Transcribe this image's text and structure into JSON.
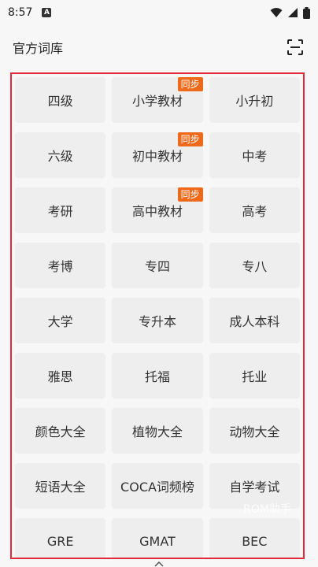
{
  "status_bar": {
    "time": "8:57",
    "notice_glyph": "A"
  },
  "header": {
    "title": "官方词库",
    "scan_icon": "scan-icon"
  },
  "grid": {
    "items": [
      {
        "label": "四级",
        "badge": ""
      },
      {
        "label": "小学教材",
        "badge": "同步"
      },
      {
        "label": "小升初",
        "badge": ""
      },
      {
        "label": "六级",
        "badge": ""
      },
      {
        "label": "初中教材",
        "badge": "同步"
      },
      {
        "label": "中考",
        "badge": ""
      },
      {
        "label": "考研",
        "badge": ""
      },
      {
        "label": "高中教材",
        "badge": "同步"
      },
      {
        "label": "高考",
        "badge": ""
      },
      {
        "label": "考博",
        "badge": ""
      },
      {
        "label": "专四",
        "badge": ""
      },
      {
        "label": "专八",
        "badge": ""
      },
      {
        "label": "大学",
        "badge": ""
      },
      {
        "label": "专升本",
        "badge": ""
      },
      {
        "label": "成人本科",
        "badge": ""
      },
      {
        "label": "雅思",
        "badge": ""
      },
      {
        "label": "托福",
        "badge": ""
      },
      {
        "label": "托业",
        "badge": ""
      },
      {
        "label": "颜色大全",
        "badge": ""
      },
      {
        "label": "植物大全",
        "badge": ""
      },
      {
        "label": "动物大全",
        "badge": ""
      },
      {
        "label": "短语大全",
        "badge": ""
      },
      {
        "label": "COCA词频榜",
        "badge": ""
      },
      {
        "label": "自学考试",
        "badge": ""
      },
      {
        "label": "GRE",
        "badge": ""
      },
      {
        "label": "GMAT",
        "badge": ""
      },
      {
        "label": "BEC",
        "badge": ""
      }
    ]
  },
  "watermark": "ROM助手",
  "colors": {
    "badge": "#ee6a1a",
    "frame": "#e02a3a",
    "cell_bg": "#eeeeee"
  }
}
